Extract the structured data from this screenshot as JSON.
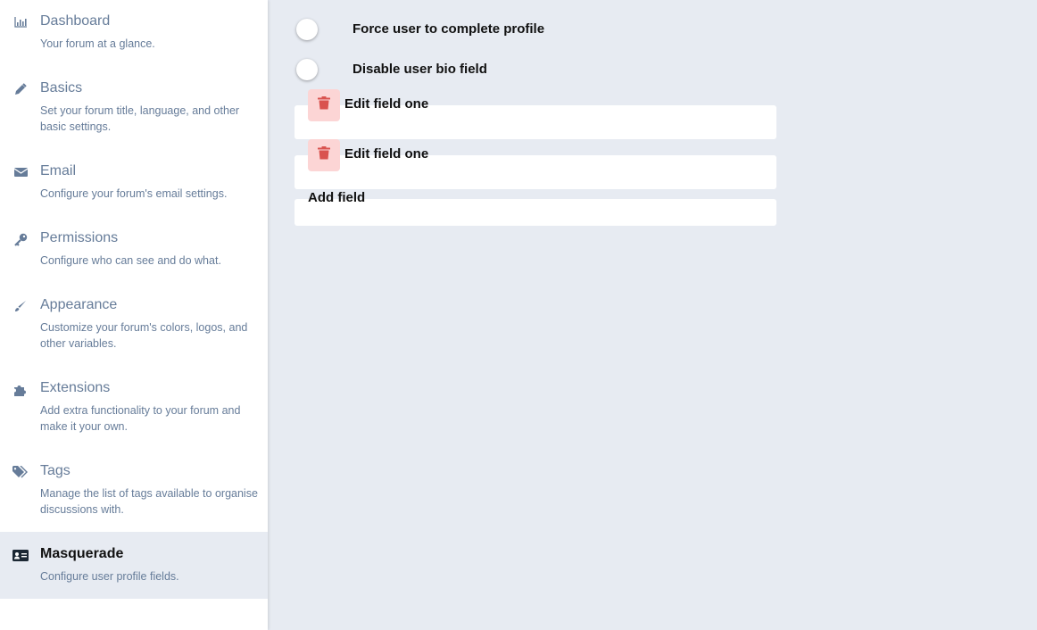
{
  "sidebar": {
    "items": [
      {
        "icon": "chart-icon",
        "title": "Dashboard",
        "description": "Your forum at a glance."
      },
      {
        "icon": "pencil-icon",
        "title": "Basics",
        "description": "Set your forum title, language, and other basic settings."
      },
      {
        "icon": "envelope-icon",
        "title": "Email",
        "description": "Configure your forum's email settings."
      },
      {
        "icon": "key-icon",
        "title": "Permissions",
        "description": "Configure who can see and do what."
      },
      {
        "icon": "paintbrush-icon",
        "title": "Appearance",
        "description": "Customize your forum's colors, logos, and other variables."
      },
      {
        "icon": "puzzle-icon",
        "title": "Extensions",
        "description": "Add extra functionality to your forum and make it your own."
      },
      {
        "icon": "tags-icon",
        "title": "Tags",
        "description": "Manage the list of tags available to organise discussions with."
      },
      {
        "icon": "id-card-icon",
        "title": "Masquerade",
        "description": "Configure user profile fields.",
        "active": true
      }
    ]
  },
  "settings": {
    "force_profile_label": "Force user to complete profile",
    "force_profile_enabled": false,
    "disable_bio_label": "Disable user bio field",
    "disable_bio_enabled": false
  },
  "fields": [
    {
      "label": "Edit field one",
      "delete_icon": "trash-icon"
    },
    {
      "label": "Edit field one",
      "delete_icon": "trash-icon"
    }
  ],
  "add_field_label": "Add field",
  "colors": {
    "accent_text": "#667c99",
    "background": "#e7ebf2",
    "danger_bg": "#fcd5d5",
    "danger_icon": "#d9534f"
  }
}
